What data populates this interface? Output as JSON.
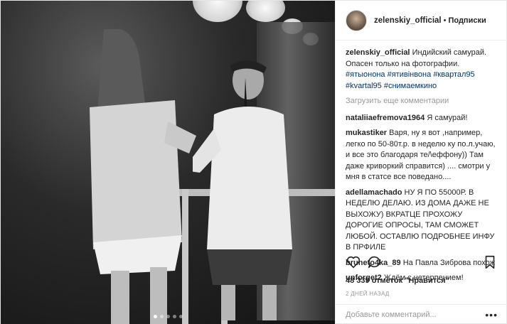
{
  "header": {
    "username": "zelenskiy_official",
    "separator": "•",
    "follow_label": "Подписки"
  },
  "caption": {
    "username": "zelenskiy_official",
    "text": "Индийский самурай. Опасен только на фотографии.",
    "tags": [
      "#ятыонона",
      "#ятивінвона",
      "#квартал95",
      "#kvartal95",
      "#снимаемкино"
    ]
  },
  "load_more": "Загрузить еще комментарии",
  "comments": [
    {
      "user": "nataliiaefremova1964",
      "text": "Я самурай!"
    },
    {
      "user": "mukastiker",
      "text": "Варя, ну я вот ,например, легко по 50-80т.р. в неделю ку по.л.учаю, и все это благодаря те/\\еффону)) Там даже криворкий справится) .... смотри у мня в статсе все поведано...."
    },
    {
      "user": "adellamachado",
      "text": "НУ Я ПО 55000Р. В НЕДЕЛЮ ДЕЛАЮ. ИЗ ДОМА ДАЖЕ НЕ ВЫХОЖУ) ВКРАТЦЕ ПРОХОЖУ ДОРОГИЕ ОПРОСЫ, ТАМ СМОЖЕТ ЛЮБОЙ. ОСТАВЛЮ ПОДРОБНЕЕ ИНФУ В ПРФИЛЕ"
    },
    {
      "user": "bruneto4ka_89",
      "text": "На Павла Зиброва похож"
    },
    {
      "user": "unforget2",
      "text": "Ждём с нетерпением!"
    }
  ],
  "likes": {
    "count": "48 339 отметок",
    "quote": "\"Нравится\""
  },
  "date": "2 ДНЕЙ НАЗАД",
  "add_comment": {
    "placeholder": "Добавьте комментарий...",
    "more": "•••"
  },
  "carousel": {
    "count": 5,
    "active": 1
  },
  "icons": [
    "heart-icon",
    "comment-icon",
    "bookmark-icon",
    "more-options-icon"
  ]
}
